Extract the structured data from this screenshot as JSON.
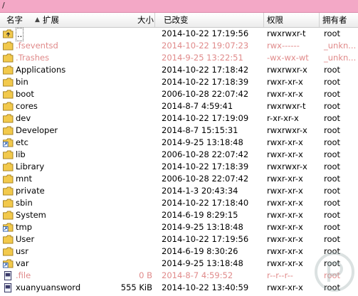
{
  "path": "/",
  "columns": {
    "name": "名字",
    "ext": "扩展",
    "size": "大小",
    "modified": "已改变",
    "perm": "权限",
    "owner": "拥有者"
  },
  "rows": [
    {
      "name": "..",
      "size": "",
      "modified": "2014-10-22 17:19:56",
      "perm": "rwxrwxr-t",
      "owner": "root",
      "icon": "parent-folder-icon",
      "dim": false
    },
    {
      "name": ".fseventsd",
      "size": "",
      "modified": "2014-10-22 19:07:23",
      "perm": "rwx------",
      "owner": "_unkn...",
      "icon": "folder-icon",
      "dim": true
    },
    {
      "name": ".Trashes",
      "size": "",
      "modified": "2014-9-25 13:22:51",
      "perm": "-wx-wx-wt",
      "owner": "_unkn...",
      "icon": "folder-icon",
      "dim": true
    },
    {
      "name": "Applications",
      "size": "",
      "modified": "2014-10-22 17:18:42",
      "perm": "rwxrwxr-x",
      "owner": "root",
      "icon": "folder-icon",
      "dim": false
    },
    {
      "name": "bin",
      "size": "",
      "modified": "2014-10-22 17:18:39",
      "perm": "rwxr-xr-x",
      "owner": "root",
      "icon": "folder-icon",
      "dim": false
    },
    {
      "name": "boot",
      "size": "",
      "modified": "2006-10-28 22:07:42",
      "perm": "rwxr-xr-x",
      "owner": "root",
      "icon": "folder-icon",
      "dim": false
    },
    {
      "name": "cores",
      "size": "",
      "modified": "2014-8-7 4:59:41",
      "perm": "rwxrwxr-t",
      "owner": "root",
      "icon": "folder-icon",
      "dim": false
    },
    {
      "name": "dev",
      "size": "",
      "modified": "2014-10-22 17:19:09",
      "perm": "r-xr-xr-x",
      "owner": "root",
      "icon": "folder-icon",
      "dim": false
    },
    {
      "name": "Developer",
      "size": "",
      "modified": "2014-8-7 15:15:31",
      "perm": "rwxrwxr-x",
      "owner": "root",
      "icon": "folder-icon",
      "dim": false
    },
    {
      "name": "etc",
      "size": "",
      "modified": "2014-9-25 13:18:48",
      "perm": "rwxr-xr-x",
      "owner": "root",
      "icon": "folder-link-icon",
      "dim": false
    },
    {
      "name": "lib",
      "size": "",
      "modified": "2006-10-28 22:07:42",
      "perm": "rwxr-xr-x",
      "owner": "root",
      "icon": "folder-icon",
      "dim": false
    },
    {
      "name": "Library",
      "size": "",
      "modified": "2014-10-22 17:18:39",
      "perm": "rwxrwxr-x",
      "owner": "root",
      "icon": "folder-icon",
      "dim": false
    },
    {
      "name": "mnt",
      "size": "",
      "modified": "2006-10-28 22:07:42",
      "perm": "rwxr-xr-x",
      "owner": "root",
      "icon": "folder-icon",
      "dim": false
    },
    {
      "name": "private",
      "size": "",
      "modified": "2014-1-3 20:43:34",
      "perm": "rwxr-xr-x",
      "owner": "root",
      "icon": "folder-icon",
      "dim": false
    },
    {
      "name": "sbin",
      "size": "",
      "modified": "2014-10-22 17:18:40",
      "perm": "rwxr-xr-x",
      "owner": "root",
      "icon": "folder-icon",
      "dim": false
    },
    {
      "name": "System",
      "size": "",
      "modified": "2014-6-19 8:29:15",
      "perm": "rwxr-xr-x",
      "owner": "root",
      "icon": "folder-icon",
      "dim": false
    },
    {
      "name": "tmp",
      "size": "",
      "modified": "2014-9-25 13:18:48",
      "perm": "rwxr-xr-x",
      "owner": "root",
      "icon": "folder-link-icon",
      "dim": false
    },
    {
      "name": "User",
      "size": "",
      "modified": "2014-10-22 17:19:56",
      "perm": "rwxr-xr-x",
      "owner": "root",
      "icon": "folder-icon",
      "dim": false
    },
    {
      "name": "usr",
      "size": "",
      "modified": "2014-6-19 8:30:26",
      "perm": "rwxr-xr-x",
      "owner": "root",
      "icon": "folder-icon",
      "dim": false
    },
    {
      "name": "var",
      "size": "",
      "modified": "2014-9-25 13:18:48",
      "perm": "rwxr-xr-x",
      "owner": "root",
      "icon": "folder-link-icon",
      "dim": false
    },
    {
      "name": ".file",
      "size": "0 B",
      "modified": "2014-8-7 4:59:52",
      "perm": "r--r--r--",
      "owner": "root",
      "icon": "file-icon",
      "dim": true
    },
    {
      "name": "xuanyuansword",
      "size": "555 KiB",
      "modified": "2014-10-22 13:40:59",
      "perm": "rwxr-xr-x",
      "owner": "root",
      "icon": "file-icon",
      "dim": false
    }
  ],
  "colors": {
    "pathbar": "#f3a8c6",
    "dim_text": "#e08a8a",
    "folder": "#f2c94c"
  }
}
